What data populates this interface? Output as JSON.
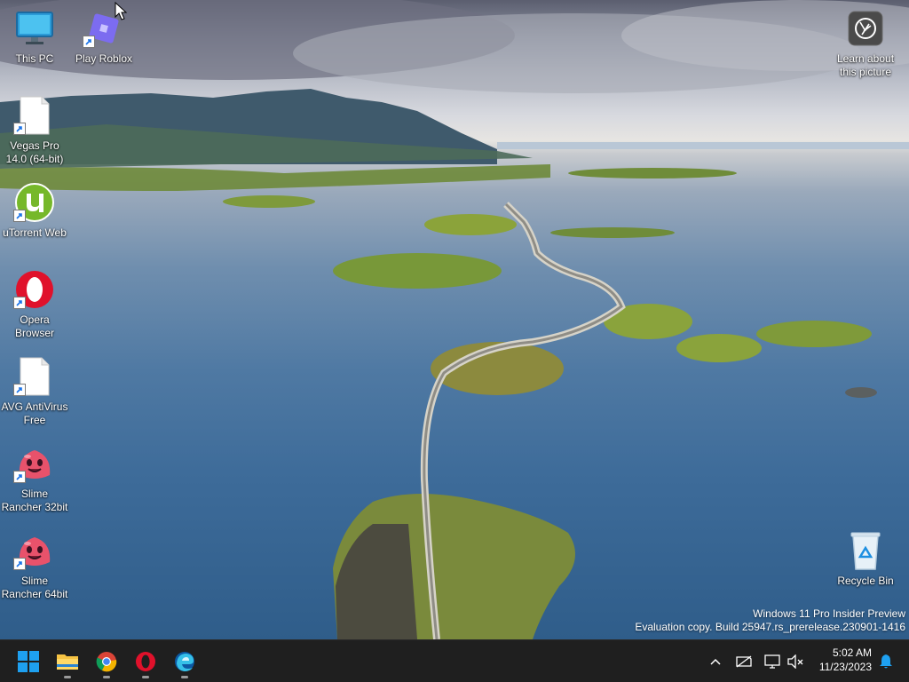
{
  "desktop_icons": [
    {
      "label": "This PC",
      "icon": "computer-icon"
    },
    {
      "label": "Play Roblox",
      "icon": "roblox-icon"
    },
    {
      "label": "Vegas Pro\n14.0 (64-bit)",
      "icon": "file-icon"
    },
    {
      "label": "uTorrent Web",
      "icon": "utorrent-icon"
    },
    {
      "label": "Opera\nBrowser",
      "icon": "opera-icon"
    },
    {
      "label": "AVG AntiVirus\nFree",
      "icon": "file-icon"
    },
    {
      "label": "Slime\nRancher 32bit",
      "icon": "slime-icon"
    },
    {
      "label": "Slime\nRancher 64bit",
      "icon": "slime-icon"
    },
    {
      "label": "Learn about\nthis picture",
      "icon": "camera-icon"
    },
    {
      "label": "Recycle Bin",
      "icon": "recycle-bin-icon"
    }
  ],
  "watermark": {
    "line1": "Windows 11 Pro Insider Preview",
    "line2": "Evaluation copy. Build 25947.rs_prerelease.230901-1416"
  },
  "taskbar": {
    "apps": [
      "start-icon",
      "file-explorer-icon",
      "chrome-icon",
      "opera-icon",
      "edge-icon"
    ],
    "tray": [
      "chevron-up-icon",
      "network-icon",
      "monitor-icon",
      "volume-muted-icon"
    ],
    "time": "5:02 AM",
    "date": "11/23/2023"
  },
  "colors": {
    "taskbar_bg": "#1f1f1f",
    "windows_blue": "#0078d4",
    "opera_red": "#e0112b"
  }
}
